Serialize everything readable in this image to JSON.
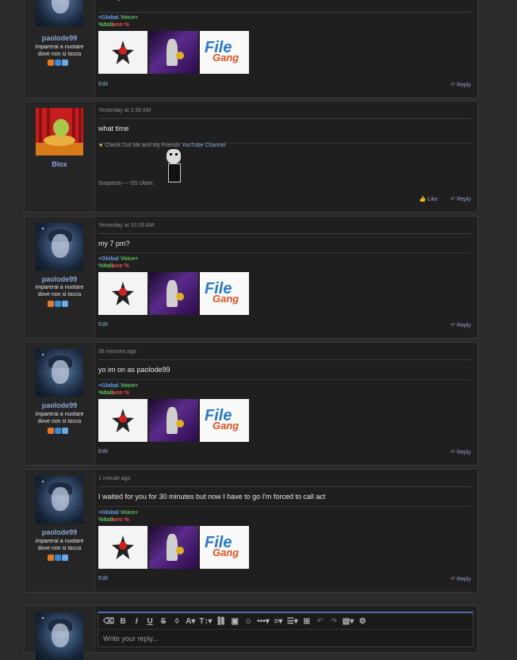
{
  "posts": [
    {
      "username": "paolode99",
      "user_title": "imparerai a nuotare dove non si tocca",
      "date": "",
      "message": "sunday",
      "sig_line1_a": "+Global ",
      "sig_line1_b": "Voice+",
      "sig_line2_a": "%Ital",
      "sig_line2_b": "i",
      "sig_line2_c": "ano %",
      "edit": "Edit",
      "reply": "Reply"
    },
    {
      "username": "Blox",
      "date": "Yesterday at 2:35 AM",
      "message": "what time",
      "sig_text": "Check Out Me and My Friends",
      "sig_link": "YouTube Channel",
      "sig_suspects": "Suspects-----SS Uben:",
      "like": "Like",
      "reply": "Reply"
    },
    {
      "username": "paolode99",
      "user_title": "imparerai a nuotare dove non si tocca",
      "date": "Yesterday at 10:28 AM",
      "message": "my 7 pm?",
      "sig_line1_a": "+Global ",
      "sig_line1_b": "Voice+",
      "sig_line2_a": "%Ital",
      "sig_line2_b": "i",
      "sig_line2_c": "ano %",
      "edit": "Edit",
      "reply": "Reply"
    },
    {
      "username": "paolode99",
      "user_title": "imparerai a nuotare dove non si tocca",
      "date": "36 minutes ago",
      "message": "yo im on as paolode99",
      "sig_line1_a": "+Global ",
      "sig_line1_b": "Voice+",
      "sig_line2_a": "%Ital",
      "sig_line2_b": "i",
      "sig_line2_c": "ano %",
      "edit": "Edit",
      "reply": "Reply"
    },
    {
      "username": "paolode99",
      "user_title": "imparerai a nuotare dove non si tocca",
      "date": "1 minute ago",
      "message": "I waited for you for 30 minutes but now I have to go I'm forced to call act",
      "sig_line1_a": "+Global ",
      "sig_line1_b": "Voice+",
      "sig_line2_a": "%Ital",
      "sig_line2_b": "i",
      "sig_line2_c": "ano %",
      "edit": "Edit",
      "reply": "Reply"
    }
  ],
  "editor": {
    "placeholder": "Write your reply...",
    "toolbar": {
      "bold": "B",
      "italic": "I",
      "underline": "U",
      "strike": "S",
      "font_size": "A",
      "text_size": "T",
      "more": "•••"
    }
  },
  "colors": {
    "accent": "#8aa6d6",
    "global": "#6a9be0",
    "voice": "#5cc15c",
    "italiano": "#e05050"
  }
}
